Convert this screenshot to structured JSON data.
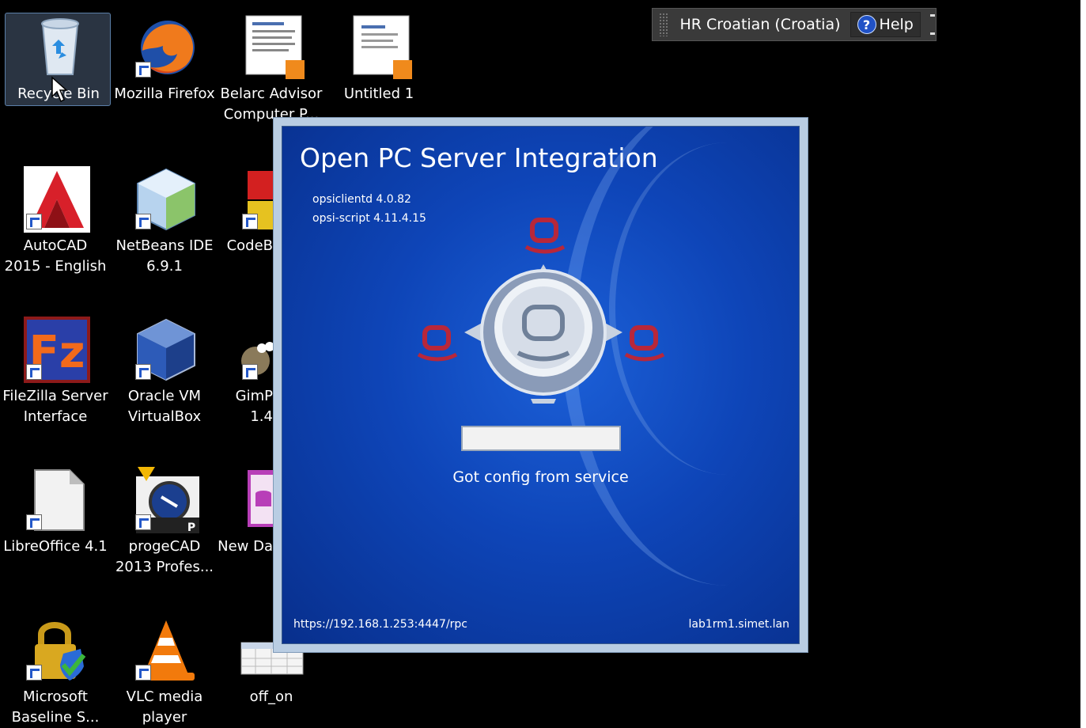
{
  "desktop": {
    "icons": [
      {
        "name": "recycle-bin",
        "label": "Recycle Bin",
        "icon": "recycle-bin-icon"
      },
      {
        "name": "mozilla-firefox",
        "label": "Mozilla Firefox",
        "icon": "firefox-icon"
      },
      {
        "name": "belarc-advisor",
        "label": "Belarc Advisor",
        "label2": "Computer P...",
        "icon": "pdf-document-icon"
      },
      {
        "name": "untitled-1",
        "label": "Untitled 1",
        "icon": "pdf-document-icon"
      },
      {
        "name": "autocad",
        "label": "AutoCAD",
        "label2": "2015 - English",
        "icon": "autocad-icon"
      },
      {
        "name": "netbeans",
        "label": "NetBeans IDE",
        "label2": "6.9.1",
        "icon": "netbeans-icon"
      },
      {
        "name": "codeblocks",
        "label": "CodeB",
        "icon": "codeblocks-icon"
      },
      {
        "name": "filezilla",
        "label": "FileZilla Server",
        "label2": "Interface",
        "icon": "filezilla-icon"
      },
      {
        "name": "virtualbox",
        "label": "Oracle VM",
        "label2": "VirtualBox",
        "icon": "virtualbox-icon"
      },
      {
        "name": "gimp",
        "label": "GimP",
        "label2": "1.4",
        "icon": "gimp-icon"
      },
      {
        "name": "libreoffice",
        "label": "LibreOffice 4.1",
        "icon": "libreoffice-icon"
      },
      {
        "name": "progecad",
        "label": "progeCAD",
        "label2": "2013 Profes...",
        "icon": "progecad-icon"
      },
      {
        "name": "new-database",
        "label": "New Da",
        "icon": "database-icon"
      },
      {
        "name": "microsoft-baseline",
        "label": "Microsoft",
        "label2": "Baseline S...",
        "icon": "mbsa-lock-icon"
      },
      {
        "name": "vlc",
        "label": "VLC media",
        "label2": "player",
        "icon": "vlc-cone-icon"
      },
      {
        "name": "off-on",
        "label": "off_on",
        "icon": "spreadsheet-icon"
      }
    ]
  },
  "langbar": {
    "language": "HR Croatian (Croatia)",
    "help_label": "Help"
  },
  "opsi": {
    "title": "Open PC Server Integration",
    "version_client": "opsiclientd 4.0.82",
    "version_script": "opsi-script 4.11.4.15",
    "progress": 0,
    "status": "Got config from service",
    "url": "https://192.168.1.253:4447/rpc",
    "host": "lab1rm1.simet.lan"
  },
  "colors": {
    "accent_red": "#b8273a",
    "window_blue": "#0e45b8"
  }
}
